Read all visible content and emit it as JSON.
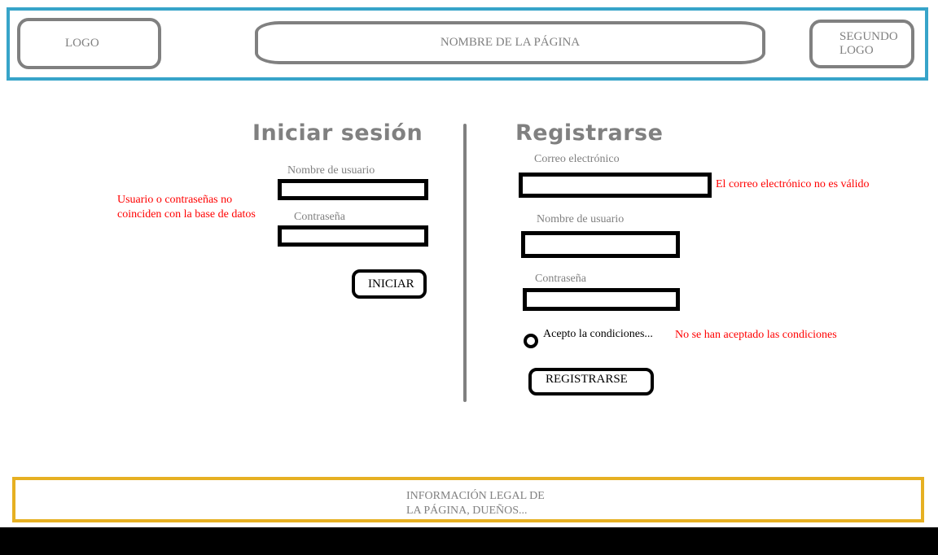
{
  "colors": {
    "header_border": "#37a4c9",
    "footer_border": "#e6b022",
    "error": "#ff0000",
    "placeholder_gray": "#808080"
  },
  "header": {
    "logo": "LOGO",
    "page_name": "NOMBRE DE LA PÁGINA",
    "second_logo_line1": "SEGUNDO",
    "second_logo_line2": "LOGO"
  },
  "login": {
    "title": "Iniciar sesión",
    "username_label": "Nombre de usuario",
    "password_label": "Contraseña",
    "error_line1": "Usuario o contraseñas no",
    "error_line2": "coinciden con la base de datos",
    "submit": "INICIAR"
  },
  "register": {
    "title": "Registrarse",
    "email_label": "Correo electrónico",
    "email_error": "El correo electrónico no es válido",
    "username_label": "Nombre de usuario",
    "password_label": "Contraseña",
    "terms_label": "Acepto la condiciones...",
    "terms_error": "No se han aceptado las condiciones",
    "submit": "REGISTRARSE"
  },
  "footer": {
    "line1": "INFORMACIÓN LEGAL DE",
    "line2": "LA PÁGINA, DUEÑOS..."
  }
}
